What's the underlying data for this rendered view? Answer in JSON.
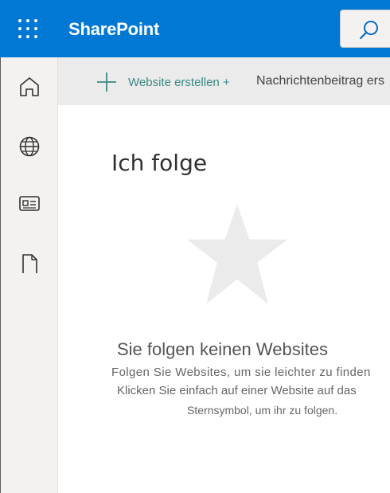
{
  "header": {
    "app_name": "SharePoint",
    "brand_color": "#0078d4",
    "waffle_icon": "app-launcher-icon",
    "search_icon": "search-icon"
  },
  "nav": {
    "items": [
      {
        "icon": "home-icon"
      },
      {
        "icon": "globe-icon"
      },
      {
        "icon": "news-icon"
      },
      {
        "icon": "document-icon"
      }
    ]
  },
  "commands": {
    "create_site_label": "Website erstellen +",
    "news_post_label": "Nachrichtenbeitrag ers"
  },
  "main": {
    "title": "Ich folge",
    "empty": {
      "title": "Sie folgen keinen Websites",
      "line1": "Folgen Sie Websites, um sie leichter zu finden",
      "line2": "Klicken Sie einfach auf einer Website auf das",
      "line3": "Sternsymbol, um ihr zu folgen."
    }
  }
}
